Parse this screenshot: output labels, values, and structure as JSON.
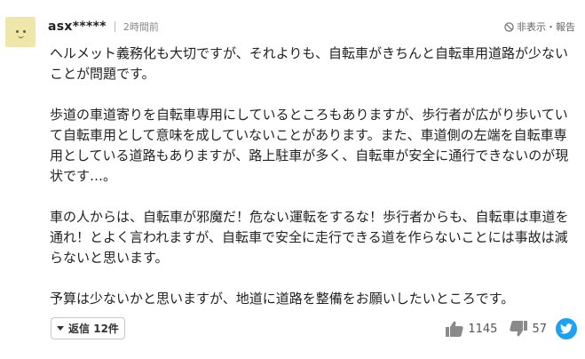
{
  "comment": {
    "username": "asx*****",
    "time": "2時間前",
    "hide_report": "非表示・報告",
    "paragraphs": [
      "ヘルメット義務化も大切ですが、それよりも、自転車がきちんと自転車用道路が少ない\nことが問題です。",
      "歩道の車道寄りを自転車専用にしているところもありますが、歩行者が広がり歩いてい\nて自転車用として意味を成していないことがあります。また、車道側の左端を自転車専\n用としている道路もありますが、路上駐車が多く、自転車が安全に通行できないのが現\n状です…。",
      "車の人からは、自転車が邪魔だ！危ない運転をするな！歩行者からも、自転車は車道を\n通れ！とよく言われますが、自転車で安全に走行できる道を作らないことには事故は減\nらないと思います。",
      "予算は少ないかと思いますが、地道に道路を整備をお願いしたいところです。"
    ],
    "reply_label": "返信 12件",
    "likes": "1145",
    "dislikes": "57"
  },
  "icons": {
    "avatar": "smiley-avatar",
    "hide": "prohibit-icon",
    "like": "thumbs-up-icon",
    "dislike": "thumbs-down-icon",
    "share": "twitter-icon"
  },
  "colors": {
    "avatar_bg": "#efe6a9",
    "twitter": "#1da1f2",
    "muted": "#888888"
  }
}
